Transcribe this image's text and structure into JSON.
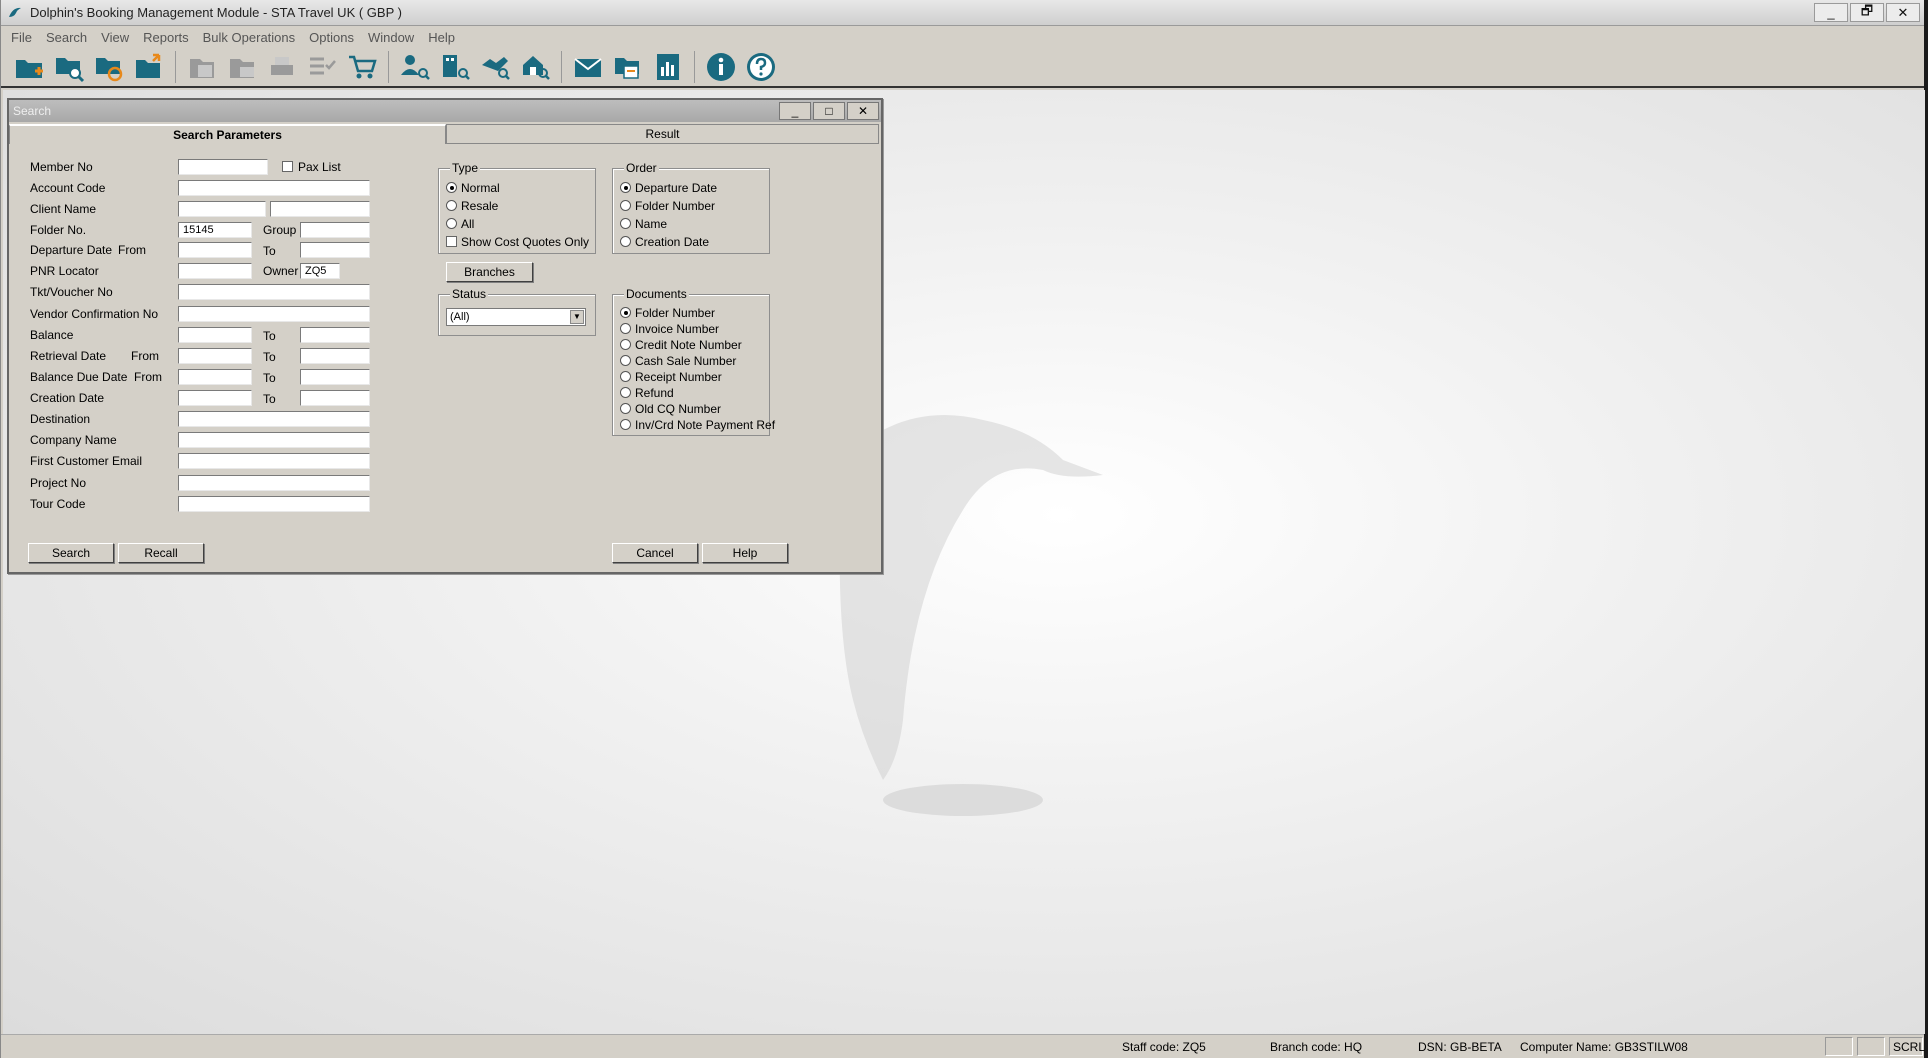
{
  "window": {
    "title": "Dolphin's Booking Management Module - STA Travel UK ( GBP )",
    "minimize": "_",
    "restore": "🗗",
    "close": "✕"
  },
  "menu": [
    "File",
    "Search",
    "View",
    "Reports",
    "Bulk Operations",
    "Options",
    "Window",
    "Help"
  ],
  "toolbar": {
    "icons": [
      "new-folder-icon",
      "search-folder-icon",
      "recall-folder-icon",
      "open-folder-icon",
      "document-list-icon",
      "mail-folder-icon",
      "print-icon",
      "checklist-icon",
      "cart-icon",
      "customer-search-icon",
      "company-search-icon",
      "agent-search-icon",
      "branch-search-icon",
      "mail-icon",
      "folder-transfer-icon",
      "report-icon",
      "info-icon",
      "help-icon"
    ],
    "accent": "#1a6a80"
  },
  "dialog": {
    "title": "Search",
    "minimize": "_",
    "maximize": "□",
    "close": "✕",
    "tabs": {
      "params": "Search Parameters",
      "result": "Result"
    },
    "fields": {
      "member_no": "Member No",
      "pax_list": "Pax List",
      "account_code": "Account Code",
      "client_name": "Client Name",
      "folder_no": "Folder No.",
      "folder_no_value": "15145",
      "group": "Group",
      "departure_date": "Departure Date",
      "from": "From",
      "to": "To",
      "pnr_locator": "PNR Locator",
      "owner": "Owner",
      "owner_value": "ZQ5",
      "tkt_voucher": "Tkt/Voucher No",
      "vendor_conf": "Vendor Confirmation No",
      "balance": "Balance",
      "retrieval_date": "Retrieval Date",
      "balance_due_date": "Balance Due Date",
      "creation_date": "Creation Date",
      "destination": "Destination",
      "company_name": "Company Name",
      "first_customer_email": "First Customer Email",
      "project_no": "Project No",
      "tour_code": "Tour Code"
    },
    "type": {
      "title": "Type",
      "options": [
        "Normal",
        "Resale",
        "All"
      ],
      "selected": "Normal",
      "cost_quotes": "Show Cost Quotes Only"
    },
    "order": {
      "title": "Order",
      "options": [
        "Departure Date",
        "Folder Number",
        "Name",
        "Creation Date"
      ],
      "selected": "Departure Date"
    },
    "branches": "Branches",
    "status": {
      "title": "Status",
      "value": "(All)"
    },
    "documents": {
      "title": "Documents",
      "options": [
        "Folder Number",
        "Invoice Number",
        "Credit Note Number",
        "Cash Sale Number",
        "Receipt Number",
        "Refund",
        "Old CQ Number",
        "Inv/Crd Note Payment Ref"
      ],
      "selected": "Folder Number"
    },
    "buttons": {
      "search": "Search",
      "recall": "Recall",
      "cancel": "Cancel",
      "help": "Help"
    }
  },
  "status": {
    "staff": "Staff code: ZQ5",
    "branch": "Branch code: HQ",
    "dsn": "DSN: GB-BETA",
    "computer": "Computer Name: GB3STILW08",
    "scrl": "SCRL"
  }
}
